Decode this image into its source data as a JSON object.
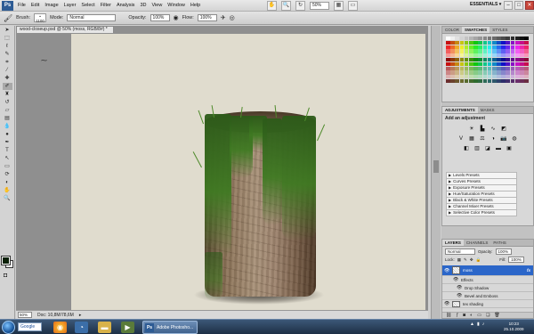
{
  "app": {
    "logo": "Ps",
    "menu": [
      "File",
      "Edit",
      "Image",
      "Layer",
      "Select",
      "Filter",
      "Analysis",
      "3D",
      "View",
      "Window",
      "Help"
    ],
    "zoom_menu_value": "50%",
    "workspace": "ESSENTIALS ▾",
    "window_controls": [
      "–",
      "□",
      "✕"
    ]
  },
  "options_bar": {
    "brush_label": "Brush:",
    "brush_size": "1100",
    "mode_label": "Mode:",
    "mode_value": "Normal",
    "opacity_label": "Opacity:",
    "opacity_value": "100%",
    "flow_label": "Flow:",
    "flow_value": "100%"
  },
  "document": {
    "tab_title": "wood-closeup.psd @ 50% (moss, RGB/8#) *",
    "zoom": "50%",
    "doc_size": "Doc: 10,8M/78,6M"
  },
  "colors": {
    "foreground": "#0b2007",
    "background": "#ffffff",
    "canvas": "#e0dcce",
    "selection": "#2b66c9"
  },
  "swatches_panel": {
    "tabs": [
      "COLOR",
      "SWATCHES",
      "STYLES"
    ],
    "active_tab": "SWATCHES"
  },
  "adjustments_panel": {
    "tabs": [
      "ADJUSTMENTS",
      "MASKS"
    ],
    "title": "Add an adjustment",
    "presets": [
      "Levels Presets",
      "Curves Presets",
      "Exposure Presets",
      "Hue/Saturation Presets",
      "Black & White Presets",
      "Channel Mixer Presets",
      "Selective Color Presets"
    ]
  },
  "layers_panel": {
    "tabs": [
      "LAYERS",
      "CHANNELS",
      "PATHS"
    ],
    "blend_mode": "Normal",
    "opacity_label": "Opacity:",
    "opacity_value": "100%",
    "lock_label": "Lock:",
    "fill_label": "Fill:",
    "fill_value": "100%",
    "layers": [
      {
        "name": "moss",
        "fx": "fx"
      },
      {
        "name": "Effects"
      },
      {
        "name": "Drop Shadow"
      },
      {
        "name": "Bevel and Emboss"
      },
      {
        "name": "tex shading"
      }
    ]
  },
  "taskbar": {
    "search_text": "Google",
    "active_task": "Adobe Photosho...",
    "clock_time": "10:23",
    "clock_date": "25.10.2009"
  }
}
